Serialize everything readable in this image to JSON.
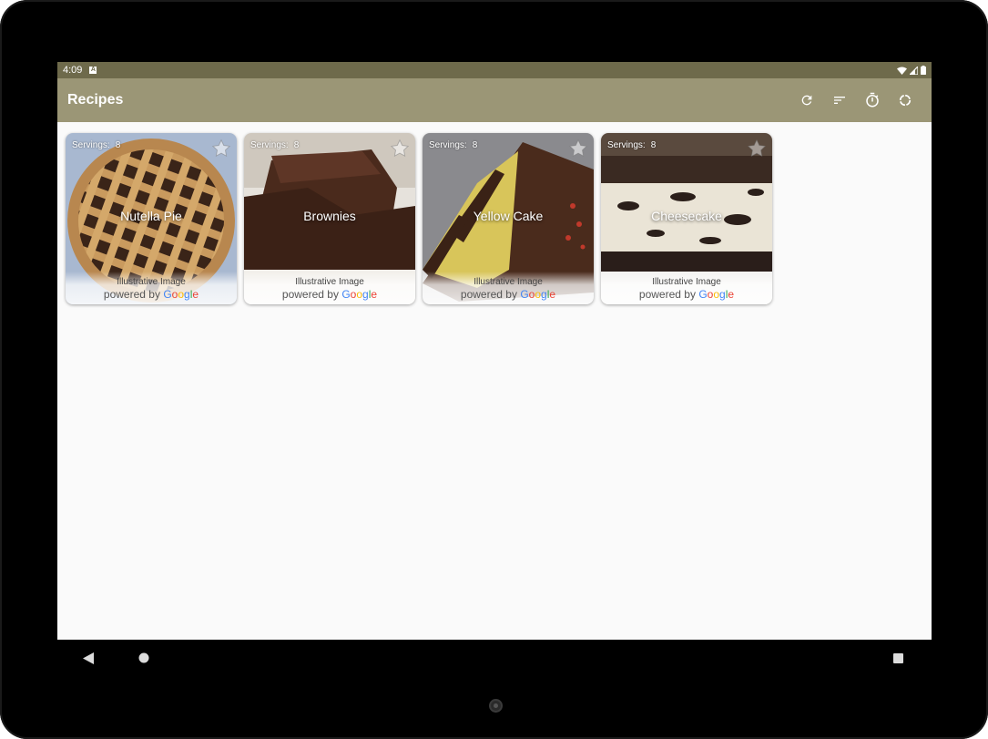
{
  "status_bar": {
    "time": "4:09",
    "notification_icon_label": "A"
  },
  "app_bar": {
    "title": "Recipes",
    "actions": [
      "refresh-icon",
      "sort-icon",
      "timer-icon",
      "sync-icon"
    ]
  },
  "recipes": [
    {
      "name": "Nutella Pie",
      "servings_label": "Servings:",
      "servings": "8"
    },
    {
      "name": "Brownies",
      "servings_label": "Servings:",
      "servings": "8"
    },
    {
      "name": "Yellow Cake",
      "servings_label": "Servings:",
      "servings": "8"
    },
    {
      "name": "Cheesecake",
      "servings_label": "Servings:",
      "servings": "8"
    }
  ],
  "image_attribution": {
    "caption": "Illustrative Image",
    "powered_by": "powered by",
    "brand": "Google"
  },
  "colors": {
    "status_bar": "#6e6a4b",
    "app_bar": "#9b9676",
    "background": "#fafafa"
  }
}
